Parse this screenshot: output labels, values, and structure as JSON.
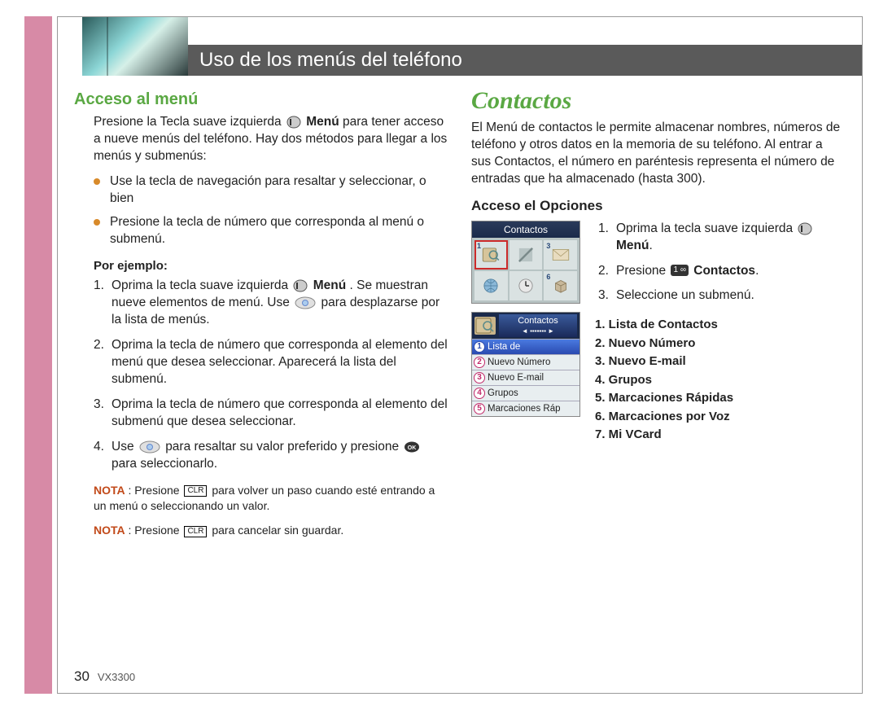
{
  "header": {
    "title": "Uso de los menús del teléfono"
  },
  "left": {
    "heading": "Acceso al menú",
    "intro_before": "Presione la Tecla suave izquierda ",
    "intro_bold": "Menú",
    "intro_after": " para tener acceso a nueve menús del teléfono. Hay dos métodos para llegar a los menús y submenús:",
    "bullets": [
      "Use la tecla de navegación para resaltar y seleccionar, o bien",
      "Presione la tecla de número que corresponda al menú o submenú."
    ],
    "por_ejemplo": "Por ejemplo:",
    "steps": {
      "s1a": "Oprima la tecla suave izquierda ",
      "s1_bold": "Menú",
      "s1b": ". Se muestran nueve elementos de menú. Use ",
      "s1c": " para desplazarse por la lista de menús.",
      "s2": "Oprima la tecla de número que corresponda al elemento del menú que desea seleccionar. Aparecerá la lista del submenú.",
      "s3": "Oprima la tecla de número que corresponda al elemento del submenú que desea seleccionar.",
      "s4a": "Use ",
      "s4b": " para resaltar su valor preferido y presione ",
      "s4c": " para seleccionarlo."
    },
    "nota1_label": "NOTA",
    "nota1_before": " : Presione ",
    "nota1_clr": "CLR",
    "nota1_after": " para volver un paso cuando esté entrando a un menú o seleccionando un valor.",
    "nota2_label": "NOTA",
    "nota2_before": " : Presione ",
    "nota2_clr": "CLR",
    "nota2_after": " para cancelar sin guardar."
  },
  "right": {
    "heading": "Contactos",
    "intro": "El Menú de contactos le permite almacenar nombres, números de teléfono y otros datos en la memoria de su teléfono. Al entrar a sus Contactos, el número en paréntesis representa el número de entradas que ha almacenado (hasta 300).",
    "acceso": "Acceso el Opciones",
    "screen1_title": "Contactos",
    "screen2_title": "Contactos",
    "screen2_rows": [
      "Lista de",
      "Nuevo Número",
      "Nuevo E-mail",
      "Grupos",
      "Marcaciones Ráp"
    ],
    "steps": {
      "s1a": "Oprima la tecla suave izquierda ",
      "s1_bold": "Menú",
      "s1b": ".",
      "s2a": "Presione ",
      "s2_key": "1 ∞",
      "s2_bold": "Contactos",
      "s2b": ".",
      "s3": "Seleccione un submenú."
    },
    "submenus": [
      "1. Lista de Contactos",
      "2. Nuevo Número",
      "3. Nuevo E-mail",
      "4. Grupos",
      "5. Marcaciones Rápidas",
      "6. Marcaciones por Voz",
      "7. Mi VCard"
    ]
  },
  "footer": {
    "page": "30",
    "model": "VX3300"
  }
}
